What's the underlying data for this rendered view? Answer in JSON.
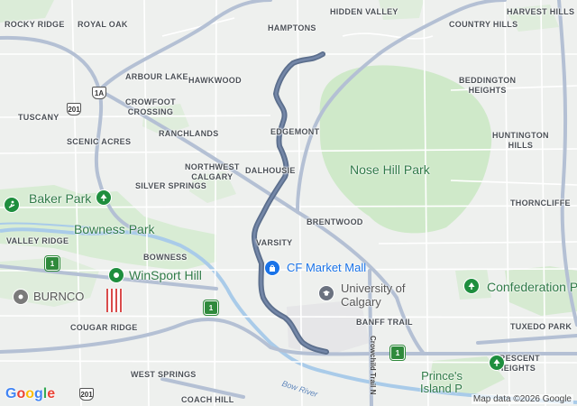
{
  "map": {
    "neighbourhoods": {
      "rocky_ridge": "ROCKY RIDGE",
      "royal_oak": "ROYAL OAK",
      "hamptons": "HAMPTONS",
      "hidden_valley": "HIDDEN VALLEY",
      "country_hills": "COUNTRY HILLS",
      "harvest_hills": "HARVEST HILLS",
      "arbour_lake": "ARBOUR LAKE",
      "hawkwood": "HAWKWOOD",
      "beddington_heights": "BEDDINGTON\nHEIGHTS",
      "crowfoot_crossing": "CROWFOOT\nCROSSING",
      "tuscany": "TUSCANY",
      "ranchlands": "RANCHLANDS",
      "edgemont": "EDGEMONT",
      "huntington_hills": "HUNTINGTON\nHILLS",
      "scenic_acres": "SCENIC ACRES",
      "northwest_calgary": "NORTHWEST\nCALGARY",
      "dalhousie": "DALHOUSIE",
      "silver_springs": "SILVER SPRINGS",
      "thorncliffe": "THORNCLIFFE",
      "brentwood": "BRENTWOOD",
      "valley_ridge": "VALLEY RIDGE",
      "bowness": "BOWNESS",
      "varsity": "VARSITY",
      "banff_trail": "BANFF TRAIL",
      "tuxedo_park": "TUXEDO PARK",
      "cougar_ridge": "COUGAR RIDGE",
      "crescent_heights": "CRESCENT\nHEIGHTS",
      "west_springs": "WEST SPRINGS",
      "coach_hill": "COACH HILL"
    },
    "parks": {
      "nose_hill_park": "Nose Hill Park",
      "baker_park": "Baker Park",
      "bowness_park": "Bowness Park",
      "winsport_hill": "WinSport Hill",
      "confederation_park": "Confederation P",
      "princes_island_park": "Prince's\nIsland P"
    },
    "pois": {
      "cf_market_mall": "CF Market Mall",
      "university_of_calgary": "University of\nCalgary",
      "burnco": "BURNCO"
    },
    "roads": {
      "crowchild_trail": "Crowchild Trail N",
      "bow_river": "Bow River"
    },
    "route_shields": {
      "hwy_1a": "1A",
      "hwy_201_north": "201",
      "hwy_201_south": "201",
      "hwy_1_west": "1",
      "hwy_1_central": "1",
      "hwy_1_east": "1"
    },
    "colors": {
      "route": "#5b6e8c",
      "park_green": "#c8e6c0",
      "park_text": "#2f7a47",
      "poi_blue": "#1a73e8",
      "poi_pin_green": "#1e8e3e",
      "water": "#9fc4e8"
    },
    "icons": {
      "shopping": "shopping-bag-icon",
      "education": "graduation-cap-icon",
      "park": "tree-icon",
      "business": "pin-icon",
      "recreation": "skier-icon"
    }
  },
  "branding": {
    "logo": "Google",
    "attribution": "Map data ©2026 Google"
  }
}
